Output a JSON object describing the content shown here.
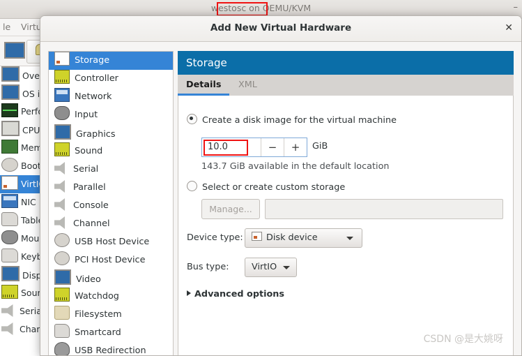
{
  "background_window": {
    "title": "westosc on QEMU/KVM",
    "title_highlight": "westosc",
    "minimize_label": "–",
    "menus": [
      "le",
      "Virtu"
    ],
    "hardware_list": [
      {
        "label": "Over",
        "icon": "monitor-icon",
        "selected": false
      },
      {
        "label": "OS i",
        "icon": "monitor-icon",
        "selected": false
      },
      {
        "label": "Perfo",
        "icon": "performance-icon",
        "selected": false
      },
      {
        "label": "CPUs",
        "icon": "cpu-icon",
        "selected": false
      },
      {
        "label": "Mem",
        "icon": "memory-icon",
        "selected": false
      },
      {
        "label": "Boot",
        "icon": "gear-icon",
        "selected": false
      },
      {
        "label": "VirtIO",
        "icon": "disk-icon",
        "selected": true
      },
      {
        "label": "NIC :",
        "icon": "network-icon",
        "selected": false
      },
      {
        "label": "Table",
        "icon": "tablet-icon",
        "selected": false
      },
      {
        "label": "Mous",
        "icon": "mouse-icon",
        "selected": false
      },
      {
        "label": "Keyb",
        "icon": "keyboard-icon",
        "selected": false
      },
      {
        "label": "Displ",
        "icon": "monitor-icon",
        "selected": false
      },
      {
        "label": "Soun",
        "icon": "sound-card-icon",
        "selected": false
      },
      {
        "label": "Seria",
        "icon": "serial-icon",
        "selected": false
      },
      {
        "label": "Chan",
        "icon": "channel-icon",
        "selected": false
      }
    ]
  },
  "dialog": {
    "title": "Add New Virtual Hardware",
    "close_label": "✕",
    "sidebar": [
      {
        "label": "Storage",
        "icon": "disk-icon",
        "active": true
      },
      {
        "label": "Controller",
        "icon": "controller-icon",
        "active": false
      },
      {
        "label": "Network",
        "icon": "network-icon",
        "active": false
      },
      {
        "label": "Input",
        "icon": "mouse-icon",
        "active": false
      },
      {
        "label": "Graphics",
        "icon": "monitor-icon",
        "active": false
      },
      {
        "label": "Sound",
        "icon": "sound-card-icon",
        "active": false
      },
      {
        "label": "Serial",
        "icon": "serial-icon",
        "active": false
      },
      {
        "label": "Parallel",
        "icon": "parallel-icon",
        "active": false
      },
      {
        "label": "Console",
        "icon": "console-icon",
        "active": false
      },
      {
        "label": "Channel",
        "icon": "channel-icon",
        "active": false
      },
      {
        "label": "USB Host Device",
        "icon": "usb-host-icon",
        "active": false
      },
      {
        "label": "PCI Host Device",
        "icon": "pci-host-icon",
        "active": false
      },
      {
        "label": "Video",
        "icon": "monitor-icon",
        "active": false
      },
      {
        "label": "Watchdog",
        "icon": "watchdog-icon",
        "active": false
      },
      {
        "label": "Filesystem",
        "icon": "folder-icon",
        "active": false
      },
      {
        "label": "Smartcard",
        "icon": "smartcard-icon",
        "active": false
      },
      {
        "label": "USB Redirection",
        "icon": "usb-icon",
        "active": false
      }
    ],
    "pane": {
      "banner": "Storage",
      "tabs": [
        {
          "label": "Details",
          "active": true
        },
        {
          "label": "XML",
          "active": false
        }
      ],
      "create_disk_option": "Create a disk image for the virtual machine",
      "size_value": "10.0",
      "size_minus": "−",
      "size_plus": "+",
      "size_unit": "GiB",
      "available_text": "143.7 GiB available in the default location",
      "custom_storage_option": "Select or create custom storage",
      "manage_button": "Manage...",
      "path_value": "",
      "device_type_label": "Device type:",
      "device_type_value": "Disk device",
      "bus_type_label": "Bus type:",
      "bus_type_value": "VirtIO",
      "advanced_options": "Advanced options"
    }
  },
  "watermark": "CSDN @是大姚呀",
  "colors": {
    "selection_blue": "#3584d6",
    "banner_blue": "#0b6ea8",
    "annotation_red": "#ef1313",
    "focus_border": "#7fa9d8"
  }
}
